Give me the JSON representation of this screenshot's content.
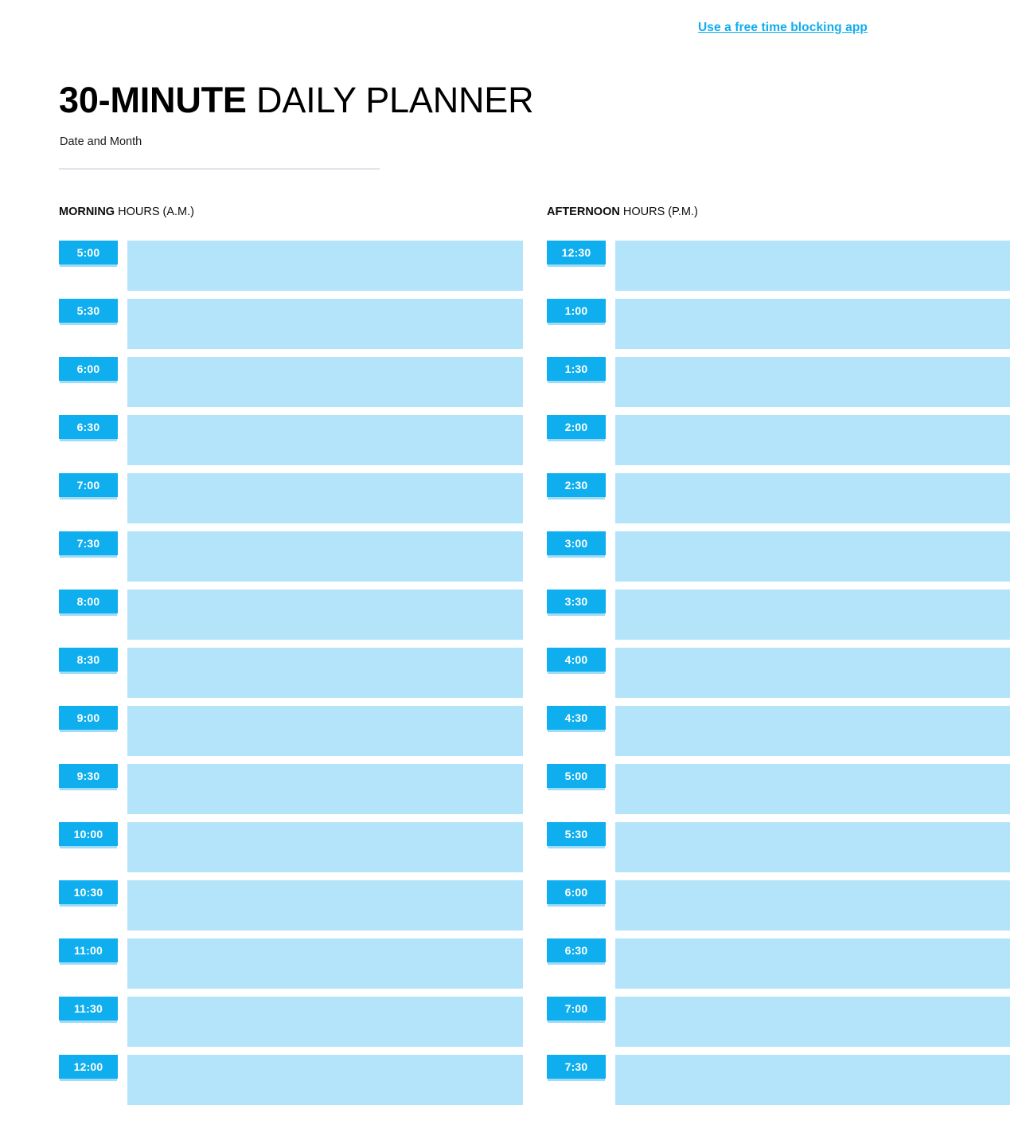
{
  "header": {
    "top_link": "Use a free time blocking app",
    "title_strong": "30-MINUTE",
    "title_light": " DAILY PLANNER"
  },
  "date_field": {
    "label": "Date and Month",
    "value": ""
  },
  "colors": {
    "accent_badge": "#0FAEEF",
    "block_fill": "#B4E4FA",
    "link": "#0FADEE",
    "rule": "#DFE5EA",
    "badge_text": "#FFFFFF",
    "text": "#000000"
  },
  "columns": [
    {
      "id": "morning",
      "head_strong": "MORNING",
      "head_light": " HOURS (A.M.)",
      "slots": [
        {
          "time": "5:00",
          "note": ""
        },
        {
          "time": "5:30",
          "note": ""
        },
        {
          "time": "6:00",
          "note": ""
        },
        {
          "time": "6:30",
          "note": ""
        },
        {
          "time": "7:00",
          "note": ""
        },
        {
          "time": "7:30",
          "note": ""
        },
        {
          "time": "8:00",
          "note": ""
        },
        {
          "time": "8:30",
          "note": ""
        },
        {
          "time": "9:00",
          "note": ""
        },
        {
          "time": "9:30",
          "note": ""
        },
        {
          "time": "10:00",
          "note": ""
        },
        {
          "time": "10:30",
          "note": ""
        },
        {
          "time": "11:00",
          "note": ""
        },
        {
          "time": "11:30",
          "note": ""
        },
        {
          "time": "12:00",
          "note": ""
        }
      ]
    },
    {
      "id": "afternoon",
      "head_strong": "AFTERNOON",
      "head_light": " HOURS (P.M.)",
      "slots": [
        {
          "time": "12:30",
          "note": ""
        },
        {
          "time": "1:00",
          "note": ""
        },
        {
          "time": "1:30",
          "note": ""
        },
        {
          "time": "2:00",
          "note": ""
        },
        {
          "time": "2:30",
          "note": ""
        },
        {
          "time": "3:00",
          "note": ""
        },
        {
          "time": "3:30",
          "note": ""
        },
        {
          "time": "4:00",
          "note": ""
        },
        {
          "time": "4:30",
          "note": ""
        },
        {
          "time": "5:00",
          "note": ""
        },
        {
          "time": "5:30",
          "note": ""
        },
        {
          "time": "6:00",
          "note": ""
        },
        {
          "time": "6:30",
          "note": ""
        },
        {
          "time": "7:00",
          "note": ""
        },
        {
          "time": "7:30",
          "note": ""
        }
      ]
    }
  ]
}
